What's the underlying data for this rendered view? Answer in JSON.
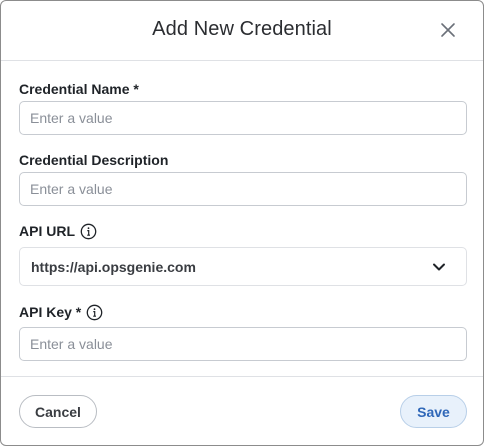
{
  "dialog": {
    "title": "Add New Credential",
    "close_icon": "close-icon"
  },
  "fields": {
    "name": {
      "label": "Credential Name *",
      "placeholder": "Enter a value",
      "value": ""
    },
    "description": {
      "label": "Credential Description",
      "placeholder": "Enter a value",
      "value": ""
    },
    "api_url": {
      "label": "API URL",
      "info_icon": "info-icon",
      "value": "https://api.opsgenie.com",
      "chevron_icon": "chevron-down-icon"
    },
    "api_key": {
      "label": "API Key *",
      "info_icon": "info-icon",
      "placeholder": "Enter a value",
      "value": ""
    }
  },
  "footer": {
    "cancel_label": "Cancel",
    "save_label": "Save"
  },
  "colors": {
    "save_bg": "#e8f1fb",
    "save_text": "#2f67b8",
    "border": "#c7cbd1"
  }
}
